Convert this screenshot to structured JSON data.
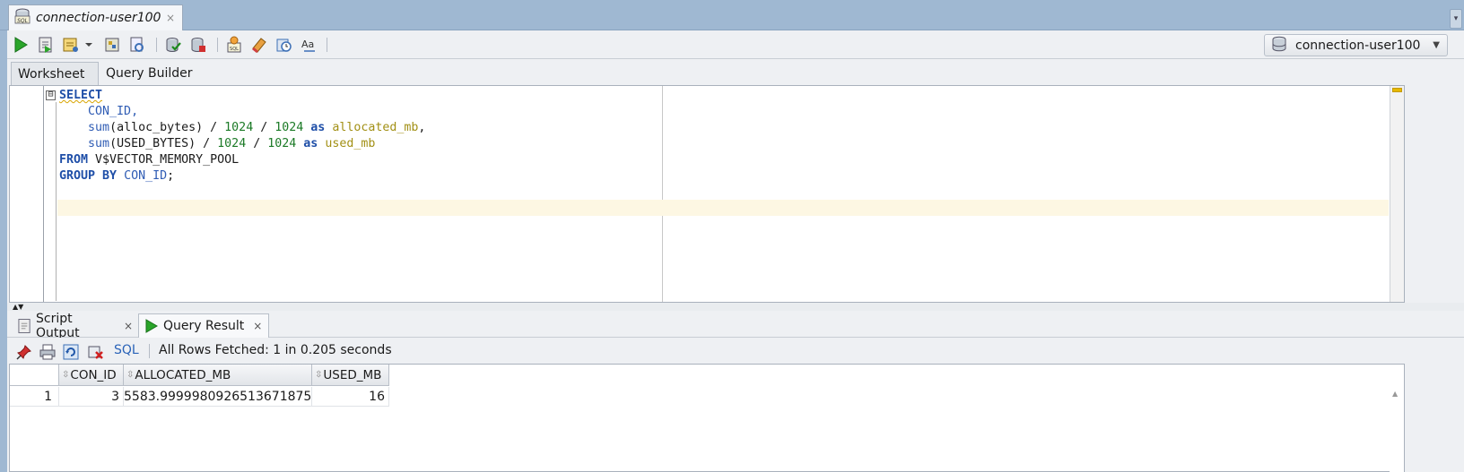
{
  "document_tab": {
    "title": "connection-user100",
    "close": "×"
  },
  "toolbar": {
    "buttons": [
      "run-statement",
      "run-script",
      "autotrace",
      "explain-plan",
      "sql-tuning",
      "commit",
      "rollback",
      "unshared-sql",
      "clear",
      "sql-history",
      "format"
    ],
    "connection_label": "connection-user100"
  },
  "worksheet_tabs": [
    {
      "label": "Worksheet"
    },
    {
      "label": "Query Builder"
    }
  ],
  "editor": {
    "line1": "SELECT",
    "line2": "CON_ID,",
    "line3_fn": "sum",
    "line3_arg": "(alloc_bytes)",
    "line3_n1": "1024",
    "line3_n2": "1024",
    "line3_as": "as",
    "line3_alias": "allocated_mb",
    "line4_fn": "sum",
    "line4_arg": "(USED_BYTES)",
    "line4_n1": "1024",
    "line4_n2": "1024",
    "line4_as": "as",
    "line4_alias": "used_mb",
    "line5_kw": "FROM",
    "line5_obj": "V$VECTOR_MEMORY_POOL",
    "line6_kw": "GROUP BY",
    "line6_col": "CON_ID",
    "fold_symbol": "⊟"
  },
  "output_tabs": [
    {
      "label": "Script Output",
      "close": "×"
    },
    {
      "label": "Query Result",
      "close": "×"
    }
  ],
  "results": {
    "sql_label": "SQL",
    "status": "All Rows Fetched: 1 in 0.205 seconds",
    "columns": [
      "CON_ID",
      "ALLOCATED_MB",
      "USED_MB"
    ],
    "rows": [
      {
        "num": "1",
        "con_id": "3",
        "allocated_mb": "5583.9999980926513671875",
        "used_mb": "16"
      }
    ]
  },
  "colors": {
    "keyword": "#1f4fa8",
    "number": "#1b7a26",
    "alias": "#a29015",
    "strip": "#9fb8d2"
  }
}
